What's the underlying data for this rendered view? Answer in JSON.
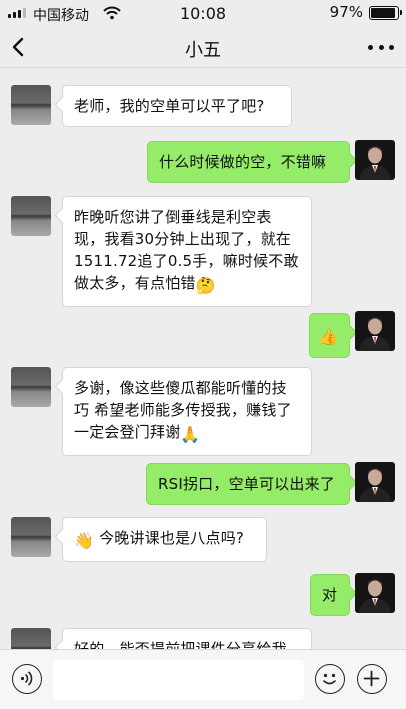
{
  "status_bar": {
    "carrier": "中国移动",
    "time": "10:08",
    "battery": "97%"
  },
  "nav": {
    "title": "小五"
  },
  "messages": [
    {
      "side": "left",
      "text": "老师，我的空单可以平了吧?"
    },
    {
      "side": "right",
      "text": "什么时候做的空，不错嘛"
    },
    {
      "side": "left",
      "text": "昨晚听您讲了倒垂线是利空表现，我看30分钟上出现了，就在1511.72追了0.5手，嘛时候不敢做太多，有点怕错"
    },
    {
      "side": "right",
      "text": "",
      "emoji": "👍"
    },
    {
      "side": "left",
      "text": "多谢，像这些傻瓜都能听懂的技巧 希望老师能多传授我，赚钱了一定会登门拜谢"
    },
    {
      "side": "right",
      "text": "RSI拐口，空单可以出来了"
    },
    {
      "side": "left",
      "text": "今晚讲课也是八点吗?"
    },
    {
      "side": "right",
      "text": "对"
    },
    {
      "side": "left",
      "text": "好的，能否提前把课件分享给我"
    }
  ],
  "icons": {
    "thinking_emoji": "🤔",
    "pray_emoji": "🙏",
    "wave_emoji": "👋",
    "thumbs_emoji": "👍"
  },
  "colors": {
    "sent_bubble": "#95ec69",
    "received_bubble": "#ffffff",
    "background": "#ededed"
  }
}
